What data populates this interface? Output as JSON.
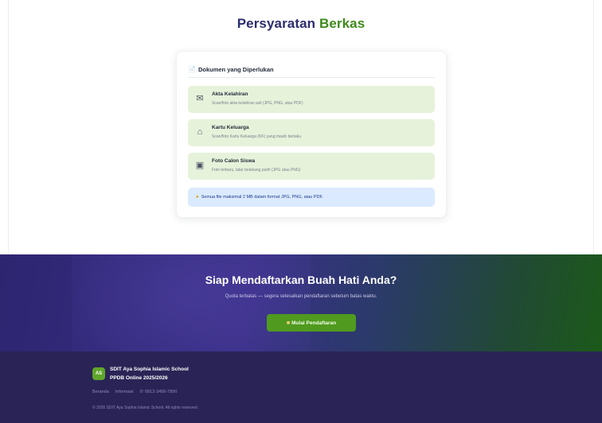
{
  "page": {
    "title_main": "Persyaratan",
    "title_accent": "Berkas"
  },
  "card": {
    "header_icon": "document-icon",
    "header": "Dokumen yang Diperlukan",
    "documents": [
      {
        "icon": "envelope-icon",
        "title": "Akta Kelahiran",
        "description": "Scan/foto akta kelahiran asli (JPG, PNG, atau PDF)"
      },
      {
        "icon": "house-icon",
        "title": "Kartu Keluarga",
        "description": "Scan/foto Kartu Keluarga (KK) yang masih berlaku"
      },
      {
        "icon": "camera-icon",
        "title": "Foto Calon Siswa",
        "description": "Foto terbaru, latar belakang putih (JPG atau PNG)"
      }
    ],
    "note_icon": "lightbulb-icon",
    "note": "Semua file maksimal 2 MB dalam format JPG, PNG, atau PDF."
  },
  "cta": {
    "title": "Siap Mendaftarkan Buah Hati Anda?",
    "subtitle": "Quota terbatas — segera selesaikan pendaftaran sebelum batas waktu.",
    "button_icon": "clipboard-icon",
    "button_label": "Mulai Pendaftaran"
  },
  "footer": {
    "logo_initials": "AS",
    "school_name": "SDIT Aya Sophia Islamic School",
    "school_sub": "PPDB Online 2025/2026",
    "links": [
      "Beranda",
      "Informasi"
    ],
    "phone_icon": "phone-icon",
    "phone": "0812-3456-7890",
    "copyright": "© 2026 SDIT Aya Sophia Islamic School. All rights reserved."
  },
  "colors": {
    "title": "#2b2d6e",
    "title_accent": "#3f8a1c",
    "doc_bg": "#e6f2da",
    "note_bg": "#dbeafe",
    "cta_bg": "#2d2570",
    "button": "#4f9a1f",
    "footer_bg": "#2a2456"
  }
}
